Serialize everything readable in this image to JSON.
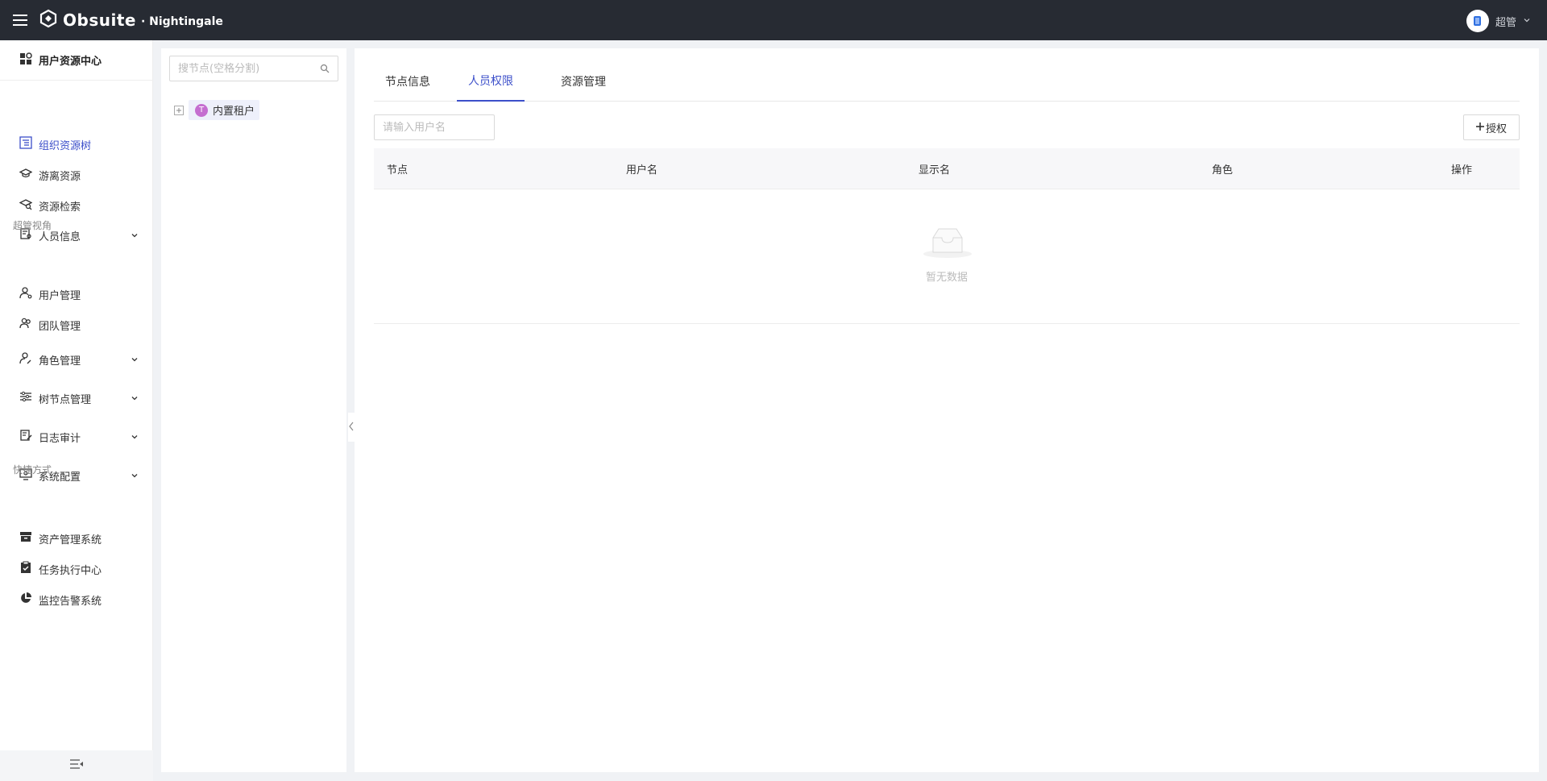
{
  "topbar": {
    "brand": "Obsuite",
    "sub": "· Nightingale",
    "user": "超管"
  },
  "sidebar": {
    "title": "用户资源中心",
    "items": [
      {
        "label": "组织资源树",
        "active": true
      },
      {
        "label": "游离资源"
      },
      {
        "label": "资源检索"
      },
      {
        "label": "人员信息",
        "expandable": true
      }
    ],
    "section_admin": "超管视角",
    "admin_items": [
      {
        "label": "用户管理"
      },
      {
        "label": "团队管理"
      },
      {
        "label": "角色管理",
        "expandable": true
      },
      {
        "label": "树节点管理",
        "expandable": true
      },
      {
        "label": "日志审计",
        "expandable": true
      },
      {
        "label": "系统配置",
        "expandable": true
      }
    ],
    "section_shortcut": "快捷方式",
    "shortcut_items": [
      {
        "label": "资产管理系统"
      },
      {
        "label": "任务执行中心"
      },
      {
        "label": "监控告警系统"
      }
    ]
  },
  "tree": {
    "search_placeholder": "搜节点(空格分割)",
    "root_badge": "T",
    "root_label": "内置租户"
  },
  "main": {
    "tabs": [
      {
        "label": "节点信息"
      },
      {
        "label": "人员权限",
        "active": true
      },
      {
        "label": "资源管理"
      }
    ],
    "user_filter_placeholder": "请输入用户名",
    "grant_button": "授权",
    "columns": [
      "节点",
      "用户名",
      "显示名",
      "角色",
      "操作"
    ],
    "empty_text": "暂无数据"
  },
  "colors": {
    "topbar": "#272b33",
    "accent": "#3c4fca",
    "tree_badge": "#c56ed0"
  }
}
